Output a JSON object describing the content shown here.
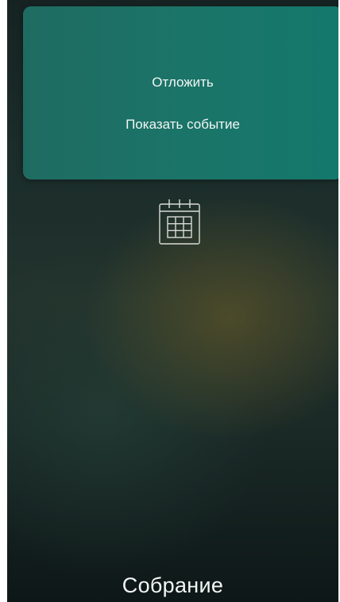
{
  "menu": {
    "snooze_label": "Отложить",
    "show_event_label": "Показать событие"
  },
  "event": {
    "title": "Собрание",
    "icon": "calendar-icon"
  },
  "colors": {
    "panel_accent": "#1b7468",
    "text": "#f2f6f4"
  }
}
